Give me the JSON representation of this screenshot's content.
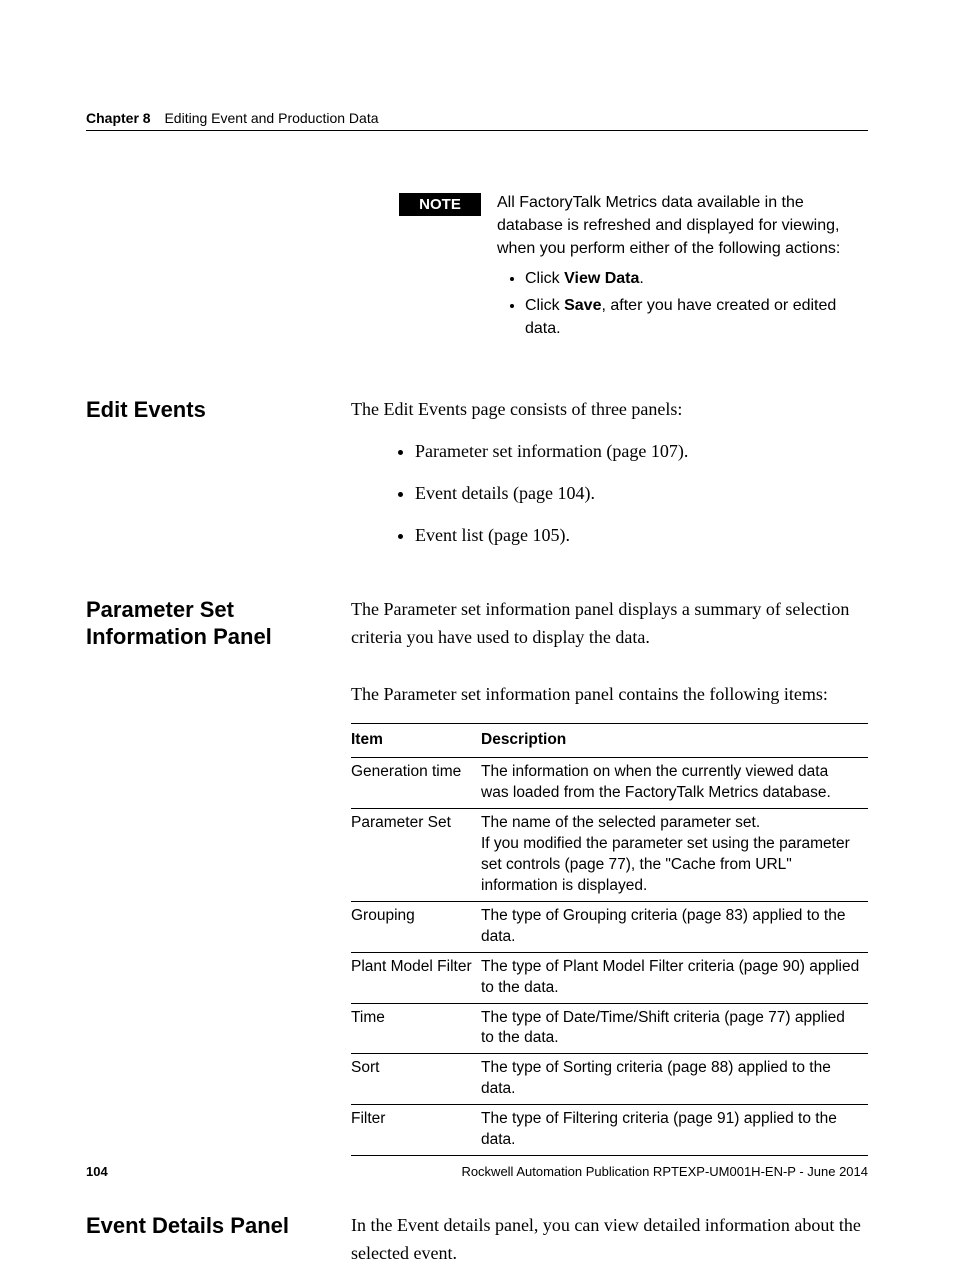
{
  "header": {
    "chapter": "Chapter 8",
    "title": "Editing Event and Production Data"
  },
  "note": {
    "badge": "NOTE",
    "intro": "All FactoryTalk Metrics data available in the database is refreshed and displayed for viewing, when you perform either of the following actions:",
    "bullets": [
      {
        "prefix": "Click ",
        "bold": "View Data",
        "suffix": "."
      },
      {
        "prefix": "Click ",
        "bold": "Save",
        "suffix": ", after you have created or edited data."
      }
    ]
  },
  "sections": {
    "edit_events": {
      "heading": "Edit Events",
      "intro": "The Edit Events page consists of three panels:",
      "bullets": [
        "Parameter set information (page 107).",
        "Event details (page 104).",
        "Event list (page 105)."
      ]
    },
    "param_panel": {
      "heading": "Parameter Set Information Panel",
      "p1": "The Parameter set information panel displays a summary of selection criteria you have used to display the data.",
      "p2": "The Parameter set information panel contains the following items:",
      "table": {
        "headers": {
          "item": "Item",
          "desc": "Description"
        },
        "rows": [
          {
            "item": "Generation time",
            "desc": "The information on when the currently viewed data was loaded from the FactoryTalk Metrics database."
          },
          {
            "item": "Parameter Set",
            "desc": "The name of the selected parameter set.\nIf you modified the parameter set using the parameter set controls (page 77), the \"Cache from URL\" information is displayed."
          },
          {
            "item": "Grouping",
            "desc": "The type of Grouping criteria (page 83) applied to the data."
          },
          {
            "item": "Plant Model Filter",
            "desc": "The type of Plant Model Filter criteria (page 90) applied to the data."
          },
          {
            "item": "Time",
            "desc": "The type of Date/Time/Shift criteria (page 77) applied to the data."
          },
          {
            "item": "Sort",
            "desc": "The type of Sorting criteria (page 88) applied to the data."
          },
          {
            "item": "Filter",
            "desc": "The type of Filtering criteria (page 91) applied to the data."
          }
        ]
      }
    },
    "event_details": {
      "heading": "Event Details Panel",
      "p1": "In the Event details panel, you can view detailed information about the selected event."
    }
  },
  "footer": {
    "page": "104",
    "pub": "Rockwell Automation Publication RPTEXP-UM001H-EN-P - June 2014"
  }
}
